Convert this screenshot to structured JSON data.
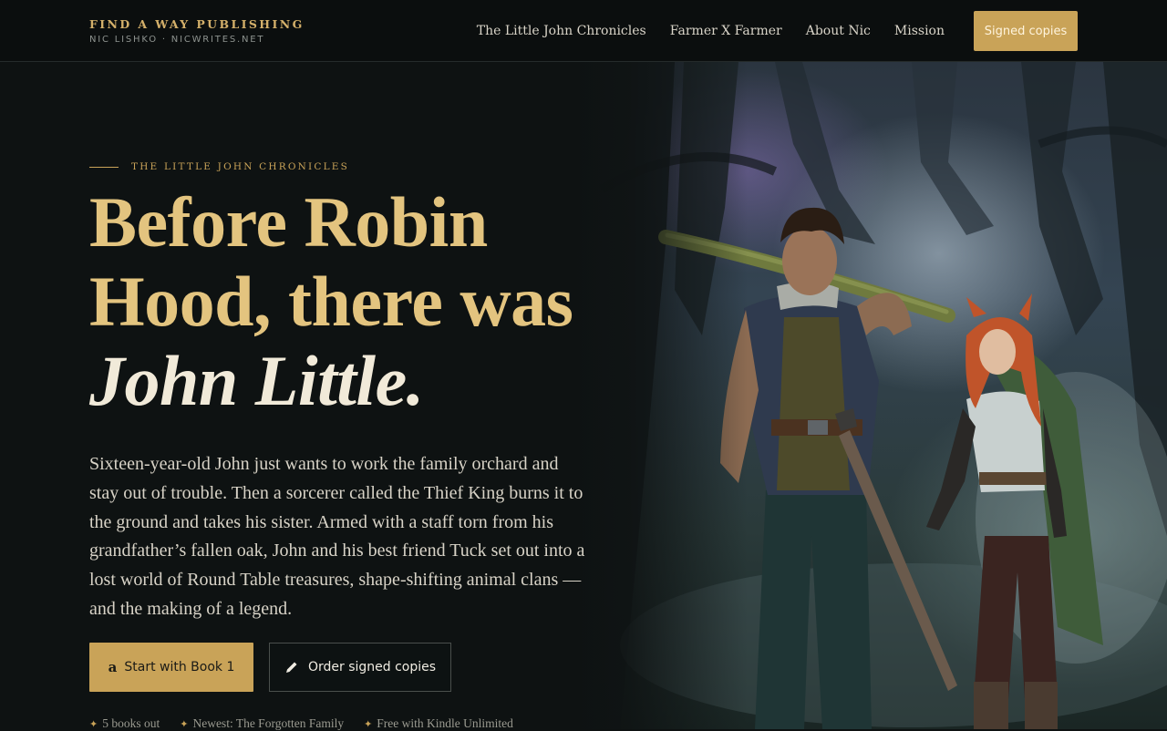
{
  "header": {
    "brand_name": "FIND A WAY PUBLISHING",
    "brand_sub": "NIC LISHKO · NICWRITES.NET",
    "nav": [
      {
        "label": "The Little John Chronicles"
      },
      {
        "label": "Farmer X Farmer"
      },
      {
        "label": "About Nic"
      },
      {
        "label": "Mission"
      }
    ],
    "cta_label": "Signed copies"
  },
  "hero": {
    "eyebrow": "THE LITTLE JOHN CHRONICLES",
    "headline_line1": "Before Robin",
    "headline_line2": "Hood, there was",
    "headline_accent": "John Little",
    "headline_period": ".",
    "lede": "Sixteen-year-old John just wants to work the family orchard and stay out of trouble. Then a sorcerer called the Thief King burns it to the ground and takes his sister. Armed with a staff torn from his grandfather’s fallen oak, John and his best friend Tuck set out into a lost world of Round Table treasures, shape-shifting animal clans — and the making of a legend.",
    "primary_button": {
      "icon_glyph": "a",
      "icon": "amazon-icon",
      "label": "Start with Book 1"
    },
    "secondary_button": {
      "icon": "pencil-icon",
      "label": "Order signed copies"
    },
    "facts": [
      {
        "icon_glyph": "✦",
        "label": "5 books out"
      },
      {
        "icon_glyph": "✦",
        "label": "Newest: The Forgotten Family"
      },
      {
        "icon_glyph": "✦",
        "label": "Free with Kindle Unlimited"
      }
    ]
  },
  "colors": {
    "background": "#0e1212",
    "gold": "#c9a358",
    "headline_gold": "#e3c47f",
    "headline_accent": "#f1ead9"
  }
}
